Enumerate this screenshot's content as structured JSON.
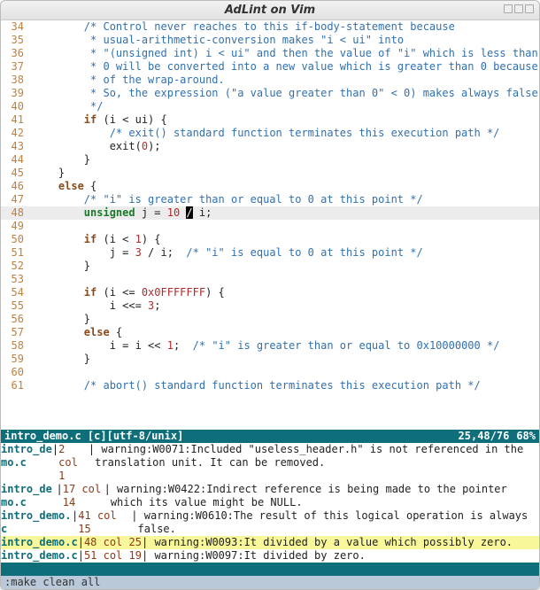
{
  "window": {
    "title": "AdLint on Vim"
  },
  "status": {
    "left": "intro_demo.c [c][utf-8/unix]",
    "right": "25,48/76",
    "pct": "68%"
  },
  "quickfix_status": "",
  "cmdline": ":make clean all",
  "lines": [
    {
      "n": "34",
      "tokens": [
        [
          "        ",
          "p"
        ],
        [
          "/* Control never reaches to this if-body-statement because",
          "c"
        ]
      ]
    },
    {
      "n": "35",
      "tokens": [
        [
          "         ",
          "p"
        ],
        [
          "* usual-arithmetic-conversion makes \"i < ui\" into",
          "c"
        ]
      ]
    },
    {
      "n": "36",
      "tokens": [
        [
          "         ",
          "p"
        ],
        [
          "* \"(unsigned int) i < ui\" and then the value of \"i\" which is less than",
          "c"
        ]
      ]
    },
    {
      "n": "37",
      "tokens": [
        [
          "         ",
          "p"
        ],
        [
          "* 0 will be converted into a new value which is greater than 0 because",
          "c"
        ]
      ]
    },
    {
      "n": "38",
      "tokens": [
        [
          "         ",
          "p"
        ],
        [
          "* of the wrap-around.",
          "c"
        ]
      ]
    },
    {
      "n": "39",
      "tokens": [
        [
          "         ",
          "p"
        ],
        [
          "* So, the expression (\"a value greater than 0\" < 0) makes always false",
          "c"
        ]
      ]
    },
    {
      "n": "40",
      "tokens": [
        [
          "         ",
          "p"
        ],
        [
          "*/",
          "c"
        ]
      ]
    },
    {
      "n": "41",
      "tokens": [
        [
          "        ",
          "p"
        ],
        [
          "if",
          "k"
        ],
        [
          " (i < ui) {",
          "p"
        ]
      ]
    },
    {
      "n": "42",
      "tokens": [
        [
          "            ",
          "p"
        ],
        [
          "/* exit() standard function terminates this execution path */",
          "c"
        ]
      ]
    },
    {
      "n": "43",
      "tokens": [
        [
          "            ",
          "p"
        ],
        [
          "exit",
          "f"
        ],
        [
          "(",
          "p"
        ],
        [
          "0",
          "n"
        ],
        [
          ");",
          "p"
        ]
      ]
    },
    {
      "n": "44",
      "tokens": [
        [
          "        }",
          "p"
        ]
      ]
    },
    {
      "n": "45",
      "tokens": [
        [
          "    }",
          "p"
        ]
      ]
    },
    {
      "n": "46",
      "tokens": [
        [
          "    ",
          "p"
        ],
        [
          "else",
          "k"
        ],
        [
          " {",
          "p"
        ]
      ]
    },
    {
      "n": "47",
      "tokens": [
        [
          "        ",
          "p"
        ],
        [
          "/* \"i\" is greater than or equal to 0 at this point */",
          "c"
        ]
      ]
    },
    {
      "n": "48",
      "current": true,
      "tokens": [
        [
          "        ",
          "p"
        ],
        [
          "unsigned",
          "t"
        ],
        [
          " j = ",
          "p"
        ],
        [
          "10",
          "n"
        ],
        [
          " ",
          "p"
        ],
        [
          "/",
          "cur"
        ],
        [
          " i;",
          "p"
        ]
      ]
    },
    {
      "n": "49",
      "tokens": [
        [
          "",
          "p"
        ]
      ]
    },
    {
      "n": "50",
      "tokens": [
        [
          "        ",
          "p"
        ],
        [
          "if",
          "k"
        ],
        [
          " (i < ",
          "p"
        ],
        [
          "1",
          "n"
        ],
        [
          ") {",
          "p"
        ]
      ]
    },
    {
      "n": "51",
      "tokens": [
        [
          "            j = ",
          "p"
        ],
        [
          "3",
          "n"
        ],
        [
          " / i;  ",
          "p"
        ],
        [
          "/* \"i\" is equal to 0 at this point */",
          "c"
        ]
      ]
    },
    {
      "n": "52",
      "tokens": [
        [
          "        }",
          "p"
        ]
      ]
    },
    {
      "n": "53",
      "tokens": [
        [
          "",
          "p"
        ]
      ]
    },
    {
      "n": "54",
      "tokens": [
        [
          "        ",
          "p"
        ],
        [
          "if",
          "k"
        ],
        [
          " (i <= ",
          "p"
        ],
        [
          "0x0FFFFFFF",
          "n"
        ],
        [
          ") {",
          "p"
        ]
      ]
    },
    {
      "n": "55",
      "tokens": [
        [
          "            i <<= ",
          "p"
        ],
        [
          "3",
          "n"
        ],
        [
          ";",
          "p"
        ]
      ]
    },
    {
      "n": "56",
      "tokens": [
        [
          "        }",
          "p"
        ]
      ]
    },
    {
      "n": "57",
      "tokens": [
        [
          "        ",
          "p"
        ],
        [
          "else",
          "k"
        ],
        [
          " {",
          "p"
        ]
      ]
    },
    {
      "n": "58",
      "tokens": [
        [
          "            i = i << ",
          "p"
        ],
        [
          "1",
          "n"
        ],
        [
          ";  ",
          "p"
        ],
        [
          "/* \"i\" is greater than or equal to 0x10000000 */",
          "c"
        ]
      ]
    },
    {
      "n": "59",
      "tokens": [
        [
          "        }",
          "p"
        ]
      ]
    },
    {
      "n": "60",
      "tokens": [
        [
          "",
          "p"
        ]
      ]
    },
    {
      "n": "61",
      "tokens": [
        [
          "        ",
          "p"
        ],
        [
          "/* abort() standard function terminates this execution path */",
          "c"
        ]
      ]
    }
  ],
  "quickfix": [
    {
      "loc": "intro_demo.c",
      "ln": "2 col 1",
      "msg": " warning:W0071:Included \"useless_header.h\" is not referenced in the translation unit. It can be removed."
    },
    {
      "loc": "intro_demo.c",
      "ln": "17 col 14",
      "msg": " warning:W0422:Indirect reference is being made to the pointer which its value might be NULL."
    },
    {
      "loc": "intro_demo.c",
      "ln": "41 col 15",
      "msg": " warning:W0610:The result of this logical operation is always false."
    },
    {
      "loc": "intro_demo.c",
      "ln": "48 col 25",
      "msg": " warning:W0093:It divided by a value which possibly zero.",
      "selected": true
    },
    {
      "loc": "intro_demo.c",
      "ln": "51 col 19",
      "msg": " warning:W0097:It divided by zero."
    }
  ]
}
